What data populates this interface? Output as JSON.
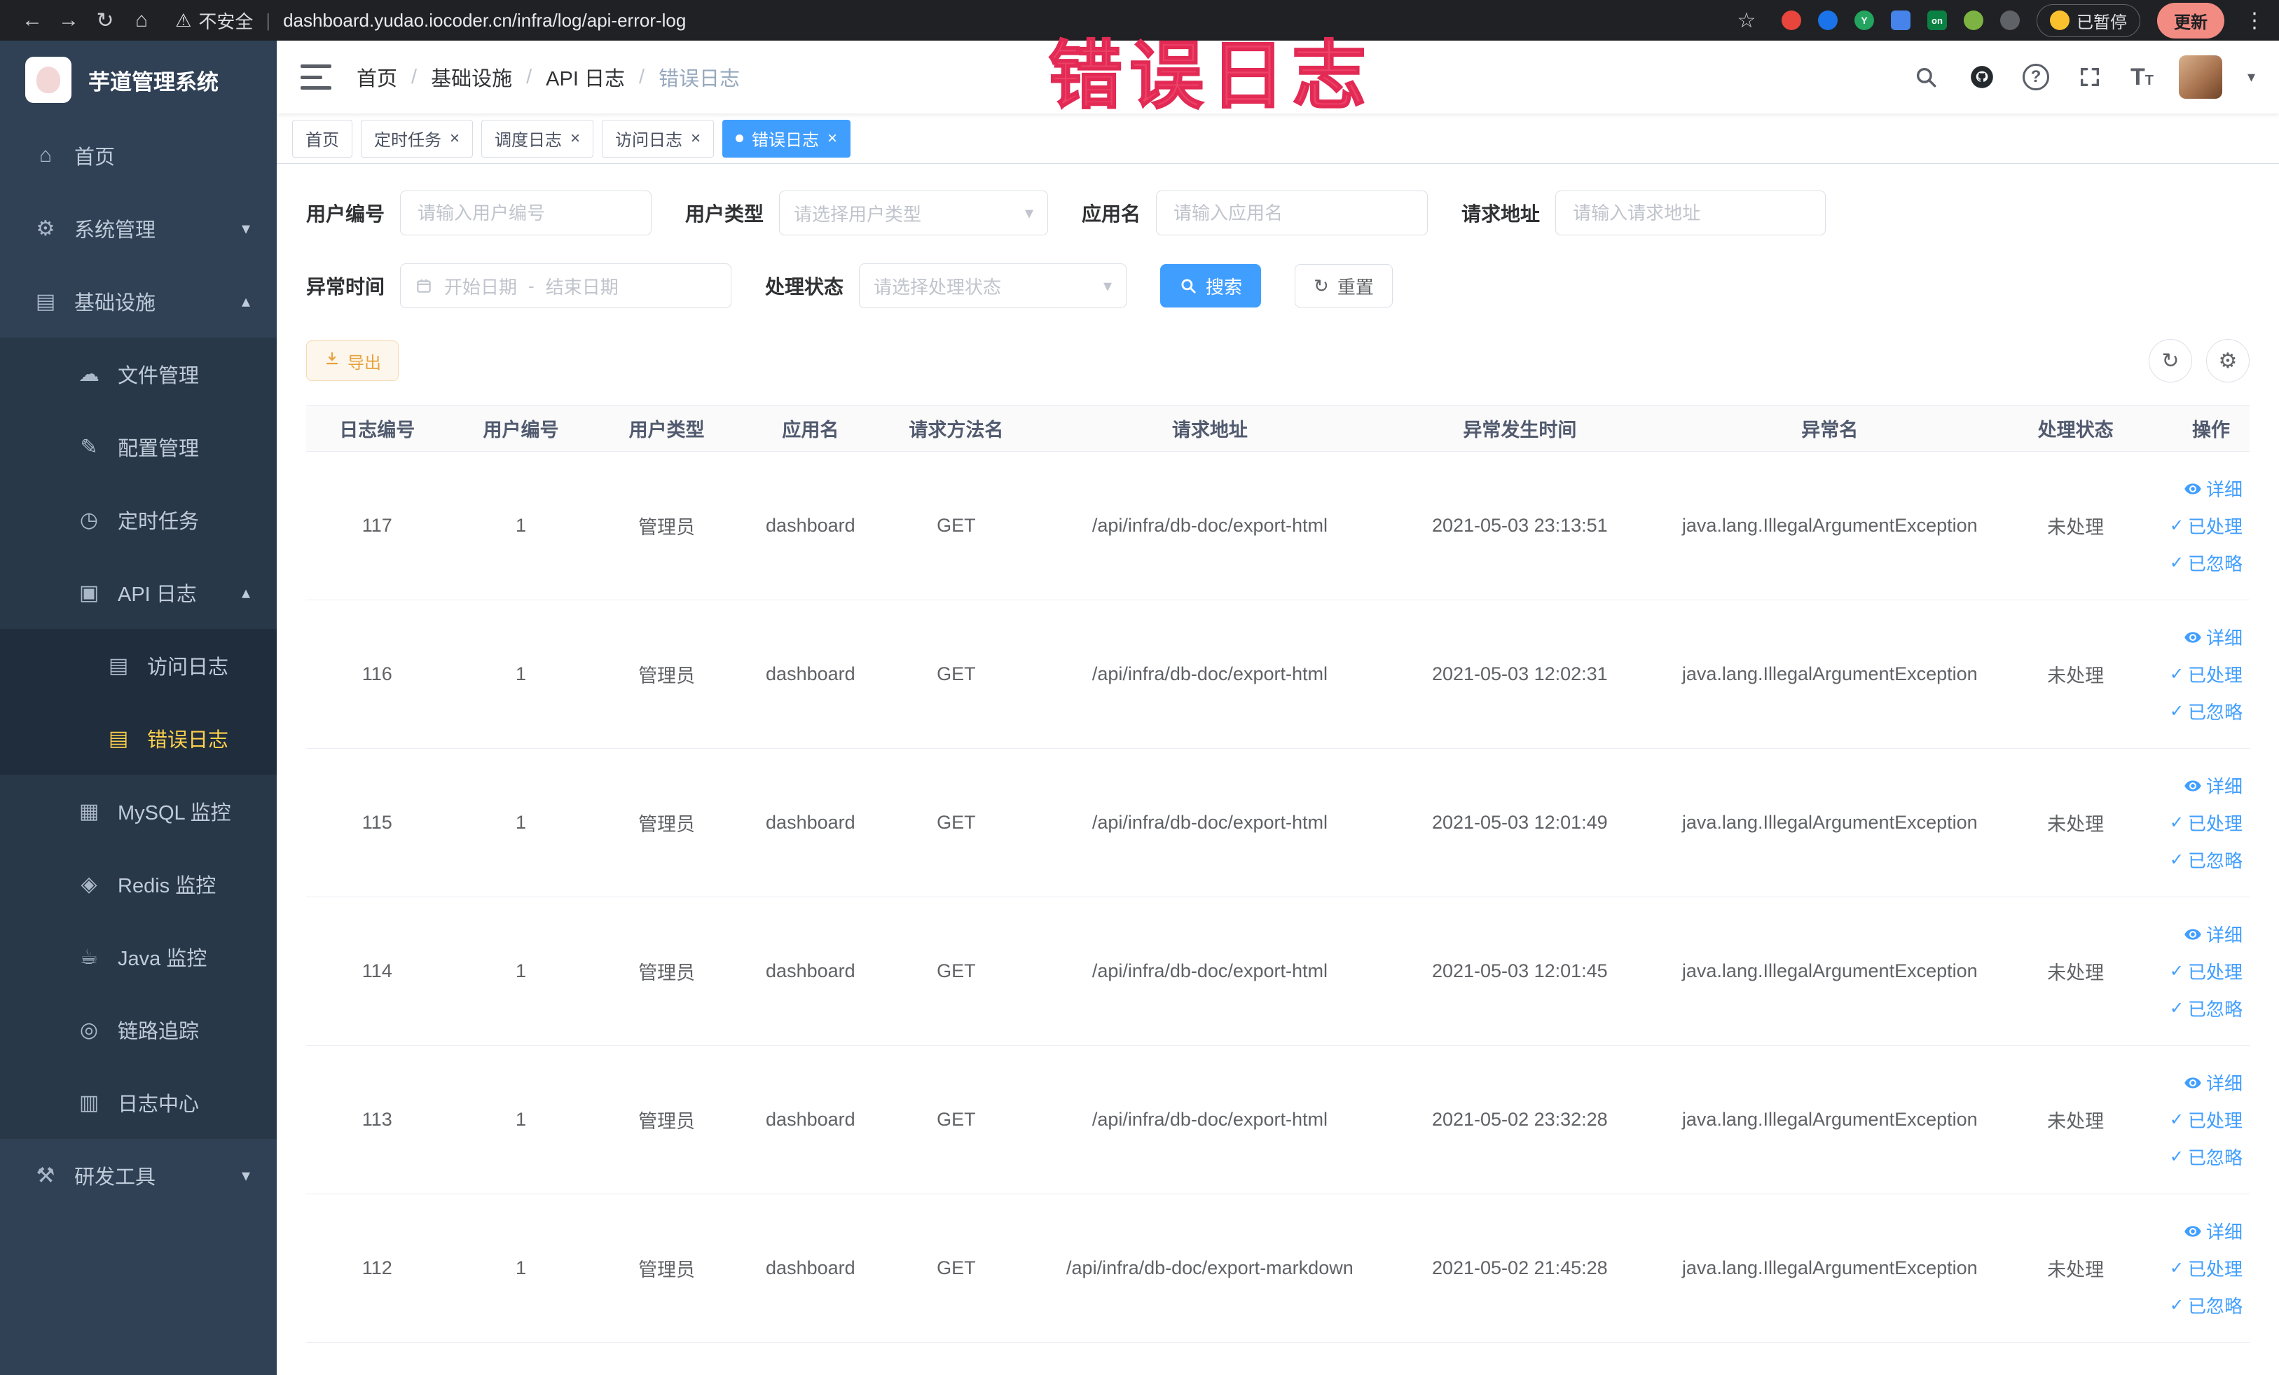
{
  "annotation": {
    "text": "错误日志"
  },
  "browser": {
    "security_label": "不安全",
    "url": "dashboard.yudao.iocoder.cn/infra/log/api-error-log",
    "paused_badge": "已暂停",
    "update_button": "更新"
  },
  "sidebar": {
    "logo_title": "芋道管理系统",
    "items": [
      {
        "id": "home",
        "label": "首页",
        "icon": "home-icon",
        "glyph": "⌂",
        "level": 1,
        "chevron": null,
        "active": false
      },
      {
        "id": "system",
        "label": "系统管理",
        "icon": "gear-icon",
        "glyph": "⚙",
        "level": 1,
        "chevron": "down",
        "active": false
      },
      {
        "id": "infra",
        "label": "基础设施",
        "icon": "monitor-icon",
        "glyph": "▤",
        "level": 1,
        "chevron": "up",
        "active": false
      },
      {
        "id": "file",
        "label": "文件管理",
        "icon": "cloud-icon",
        "glyph": "☁",
        "level": 2,
        "chevron": null,
        "active": false
      },
      {
        "id": "config",
        "label": "配置管理",
        "icon": "edit-icon",
        "glyph": "✎",
        "level": 2,
        "chevron": null,
        "active": false
      },
      {
        "id": "job",
        "label": "定时任务",
        "icon": "clock-icon",
        "glyph": "◷",
        "level": 2,
        "chevron": null,
        "active": false
      },
      {
        "id": "api-log",
        "label": "API 日志",
        "icon": "document-icon",
        "glyph": "▣",
        "level": 2,
        "chevron": "up",
        "active": false
      },
      {
        "id": "access-log",
        "label": "访问日志",
        "icon": "doc-lines-icon",
        "glyph": "▤",
        "level": 3,
        "chevron": null,
        "active": false
      },
      {
        "id": "error-log",
        "label": "错误日志",
        "icon": "doc-lines-icon",
        "glyph": "▤",
        "level": 3,
        "chevron": null,
        "active": true
      },
      {
        "id": "mysql",
        "label": "MySQL 监控",
        "icon": "database-icon",
        "glyph": "▦",
        "level": 2,
        "chevron": null,
        "active": false
      },
      {
        "id": "redis",
        "label": "Redis 监控",
        "icon": "redis-icon",
        "glyph": "◈",
        "level": 2,
        "chevron": null,
        "active": false
      },
      {
        "id": "java",
        "label": "Java 监控",
        "icon": "coffee-icon",
        "glyph": "☕",
        "level": 2,
        "chevron": null,
        "active": false
      },
      {
        "id": "trace",
        "label": "链路追踪",
        "icon": "eye-icon",
        "glyph": "◎",
        "level": 2,
        "chevron": null,
        "active": false
      },
      {
        "id": "log-center",
        "label": "日志中心",
        "icon": "log-center-icon",
        "glyph": "▥",
        "level": 2,
        "chevron": null,
        "active": false
      },
      {
        "id": "devtools",
        "label": "研发工具",
        "icon": "tools-icon",
        "glyph": "⚒",
        "level": 1,
        "chevron": "down",
        "active": false
      }
    ]
  },
  "navbar": {
    "breadcrumb": [
      "首页",
      "基础设施",
      "API 日志",
      "错误日志"
    ]
  },
  "tabs": [
    {
      "name": "tab-home",
      "label": "首页",
      "closable": false,
      "active": false
    },
    {
      "name": "tab-timed-task",
      "label": "定时任务",
      "closable": true,
      "active": false
    },
    {
      "name": "tab-schedule-log",
      "label": "调度日志",
      "closable": true,
      "active": false
    },
    {
      "name": "tab-access-log",
      "label": "访问日志",
      "closable": true,
      "active": false
    },
    {
      "name": "tab-error-log",
      "label": "错误日志",
      "closable": true,
      "active": true
    }
  ],
  "filters": {
    "user_id": {
      "label": "用户编号",
      "placeholder": "请输入用户编号"
    },
    "user_type": {
      "label": "用户类型",
      "placeholder": "请选择用户类型"
    },
    "app_name": {
      "label": "应用名",
      "placeholder": "请输入应用名"
    },
    "request_url": {
      "label": "请求地址",
      "placeholder": "请输入请求地址"
    },
    "exception_time": {
      "label": "异常时间",
      "start_placeholder": "开始日期",
      "separator": "-",
      "end_placeholder": "结束日期"
    },
    "process_status": {
      "label": "处理状态",
      "placeholder": "请选择处理状态"
    },
    "search_button": "搜索",
    "reset_button": "重置"
  },
  "toolbar": {
    "export_label": "导出"
  },
  "table": {
    "columns": [
      "日志编号",
      "用户编号",
      "用户类型",
      "应用名",
      "请求方法名",
      "请求地址",
      "异常发生时间",
      "异常名",
      "处理状态",
      "操作"
    ],
    "rows": [
      {
        "id": "117",
        "user_id": "1",
        "user_type": "管理员",
        "app": "dashboard",
        "method": "GET",
        "url": "/api/infra/db-doc/export-html",
        "time": "2021-05-03 23:13:51",
        "exception": "java.lang.IllegalArgumentException",
        "status": "未处理"
      },
      {
        "id": "116",
        "user_id": "1",
        "user_type": "管理员",
        "app": "dashboard",
        "method": "GET",
        "url": "/api/infra/db-doc/export-html",
        "time": "2021-05-03 12:02:31",
        "exception": "java.lang.IllegalArgumentException",
        "status": "未处理"
      },
      {
        "id": "115",
        "user_id": "1",
        "user_type": "管理员",
        "app": "dashboard",
        "method": "GET",
        "url": "/api/infra/db-doc/export-html",
        "time": "2021-05-03 12:01:49",
        "exception": "java.lang.IllegalArgumentException",
        "status": "未处理"
      },
      {
        "id": "114",
        "user_id": "1",
        "user_type": "管理员",
        "app": "dashboard",
        "method": "GET",
        "url": "/api/infra/db-doc/export-html",
        "time": "2021-05-03 12:01:45",
        "exception": "java.lang.IllegalArgumentException",
        "status": "未处理"
      },
      {
        "id": "113",
        "user_id": "1",
        "user_type": "管理员",
        "app": "dashboard",
        "method": "GET",
        "url": "/api/infra/db-doc/export-html",
        "time": "2021-05-02 23:32:28",
        "exception": "java.lang.IllegalArgumentException",
        "status": "未处理"
      },
      {
        "id": "112",
        "user_id": "1",
        "user_type": "管理员",
        "app": "dashboard",
        "method": "GET",
        "url": "/api/infra/db-doc/export-markdown",
        "time": "2021-05-02 21:45:28",
        "exception": "java.lang.IllegalArgumentException",
        "status": "未处理"
      }
    ],
    "row_actions": [
      {
        "name": "detail-link",
        "label": "详细",
        "icon": "eye-icon"
      },
      {
        "name": "processed-link",
        "label": "已处理",
        "icon": "check-icon"
      },
      {
        "name": "ignore-link",
        "label": "已忽略",
        "icon": "check-icon"
      }
    ]
  }
}
